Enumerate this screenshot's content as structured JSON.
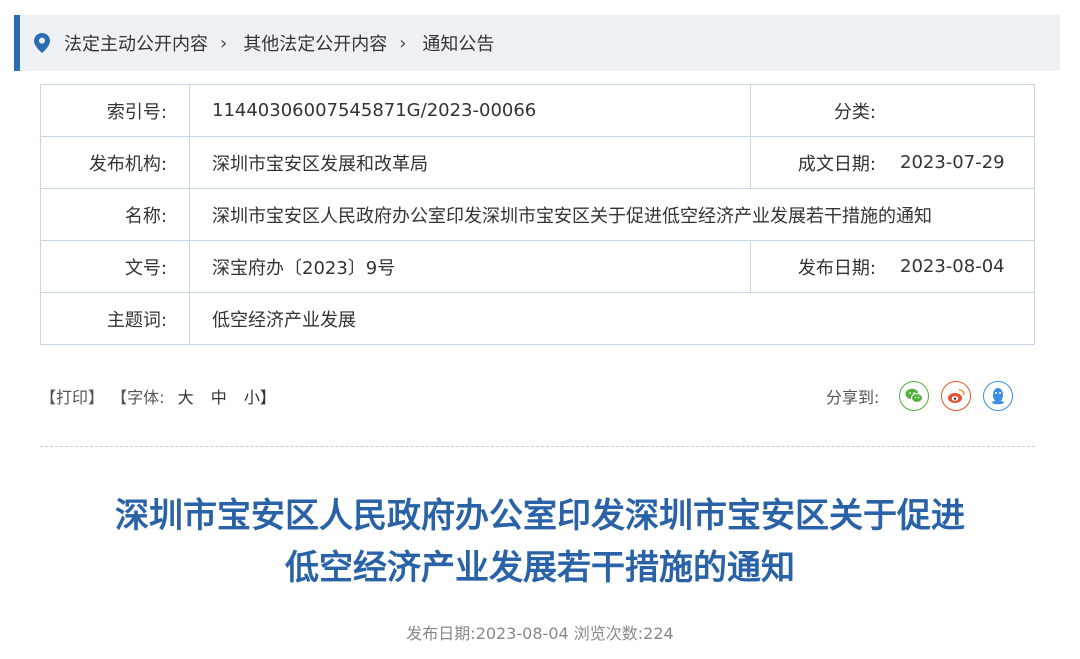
{
  "breadcrumb": {
    "items": [
      "法定主动公开内容",
      "其他法定公开内容",
      "通知公告"
    ]
  },
  "info": {
    "index_label": "索引号:",
    "index_value": "11440306007545871G/2023-00066",
    "category_label": "分类:",
    "category_value": "",
    "agency_label": "发布机构:",
    "agency_value": "深圳市宝安区发展和改革局",
    "written_date_label": "成文日期:",
    "written_date_value": "2023-07-29",
    "name_label": "名称:",
    "name_value": "深圳市宝安区人民政府办公室印发深圳市宝安区关于促进低空经济产业发展若干措施的通知",
    "doc_no_label": "文号:",
    "doc_no_value": "深宝府办〔2023〕9号",
    "publish_date_label": "发布日期:",
    "publish_date_value": "2023-08-04",
    "subject_label": "主题词:",
    "subject_value": "低空经济产业发展"
  },
  "tools": {
    "print": "【打印】",
    "font_prefix": "【字体:",
    "font_large": "大",
    "font_medium": "中",
    "font_small": "小】",
    "share_label": "分享到:",
    "share_icons": [
      "wechat-icon",
      "weibo-icon",
      "qq-icon"
    ],
    "colors": {
      "wechat": "#52b03c",
      "weibo": "#e6522c",
      "qq": "#3a8ee6"
    }
  },
  "article": {
    "title_line1": "深圳市宝安区人民政府办公室印发深圳市宝安区关于促进",
    "title_line2": "低空经济产业发展若干措施的通知",
    "meta": "发布日期:2023-08-04  浏览次数:224"
  },
  "accent_color": "#2b6cb0"
}
